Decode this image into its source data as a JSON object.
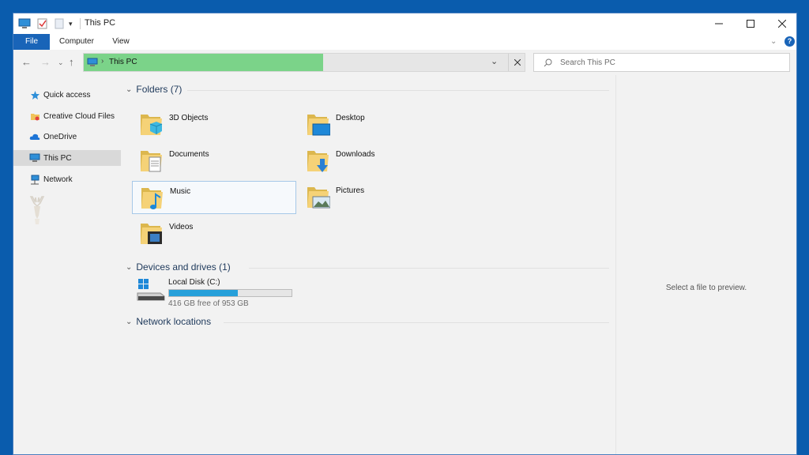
{
  "window": {
    "title": "This PC"
  },
  "ribbon": {
    "tabs": [
      "File",
      "Computer",
      "View"
    ]
  },
  "address": {
    "location": "This PC"
  },
  "search": {
    "placeholder": "Search This PC"
  },
  "sidebar": {
    "items": [
      {
        "label": "Quick access",
        "icon": "star-icon"
      },
      {
        "label": "Creative Cloud Files",
        "icon": "creative-cloud-icon"
      },
      {
        "label": "OneDrive",
        "icon": "cloud-icon"
      },
      {
        "label": "This PC",
        "icon": "computer-icon",
        "selected": true
      },
      {
        "label": "Network",
        "icon": "network-icon"
      }
    ]
  },
  "folders": {
    "header": "Folders (7)",
    "items": [
      {
        "label": "3D Objects",
        "icon": "3d-objects-folder-icon"
      },
      {
        "label": "Desktop",
        "icon": "desktop-folder-icon"
      },
      {
        "label": "Documents",
        "icon": "documents-folder-icon"
      },
      {
        "label": "Downloads",
        "icon": "downloads-folder-icon"
      },
      {
        "label": "Music",
        "icon": "music-folder-icon",
        "selected": true
      },
      {
        "label": "Pictures",
        "icon": "pictures-folder-icon"
      },
      {
        "label": "Videos",
        "icon": "videos-folder-icon"
      }
    ]
  },
  "devices": {
    "header": "Devices and drives (1)",
    "drives": [
      {
        "name": "Local Disk (C:)",
        "free_text": "416 GB free of 953 GB",
        "used_fraction": 0.564
      }
    ]
  },
  "network_locations": {
    "header": "Network locations"
  },
  "preview": {
    "message": "Select a file to preview."
  },
  "colors": {
    "accent": "#1964b8",
    "address_highlight": "#7bd389",
    "drive_fill": "#26a0da",
    "background": "#0a5cad"
  }
}
